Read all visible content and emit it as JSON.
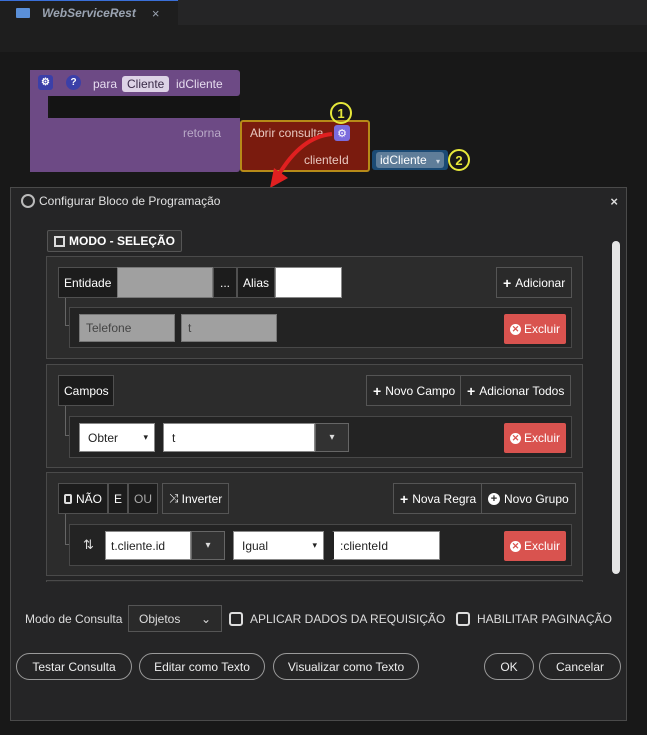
{
  "tab": {
    "label": "WebServiceRest",
    "close": "×"
  },
  "block": {
    "settings_icon": "⚙",
    "help_icon": "?",
    "para": "para",
    "param_pill": "Cliente",
    "param_name": "idCliente",
    "retorna": "retorna",
    "query_label": "Abrir consulta",
    "gear_icon": "⚙",
    "arg_label": "clienteId",
    "arg_value": "idCliente",
    "arg_caret": "▾",
    "callout_1": "1",
    "callout_2": "2"
  },
  "dialog": {
    "title": "Configurar Bloco de Programação",
    "close": "×",
    "mode_tag": "MODO - SELEÇÃO",
    "entity": {
      "label": "Entidade",
      "value": "",
      "ellipsis": "...",
      "alias_label": "Alias",
      "alias_value": "",
      "add_button": "Adicionar",
      "row": {
        "entity": "Telefone",
        "alias": "t",
        "delete": "Excluir"
      }
    },
    "fields": {
      "label": "Campos",
      "new_field_button": "Novo Campo",
      "add_all_button": "Adicionar Todos",
      "row": {
        "op": "Obter",
        "op_caret": "▾",
        "value": "t",
        "caret": "▾",
        "delete": "Excluir"
      }
    },
    "rules": {
      "not_label": "NÃO",
      "and_label": "E",
      "or_label": "OU",
      "invert_label": "Inverter",
      "new_rule_button": "Nova Regra",
      "new_group_button": "Novo Grupo",
      "row": {
        "sort_icon": "⇅",
        "field": "t.cliente.id",
        "field_caret": "▾",
        "operator": "Igual",
        "operator_caret": "▾",
        "value": ":clienteId",
        "delete": "Excluir"
      }
    },
    "footer": {
      "query_mode_label": "Modo de Consulta",
      "query_mode_value": "Objetos",
      "query_mode_caret": "⌄",
      "apply_request_label": "APLICAR DADOS DA REQUISIÇÃO",
      "paging_label": "HABILITAR PAGINAÇÃO",
      "test_button": "Testar Consulta",
      "edit_text_button": "Editar como Texto",
      "view_text_button": "Visualizar como Texto",
      "ok_button": "OK",
      "cancel_button": "Cancelar"
    }
  }
}
